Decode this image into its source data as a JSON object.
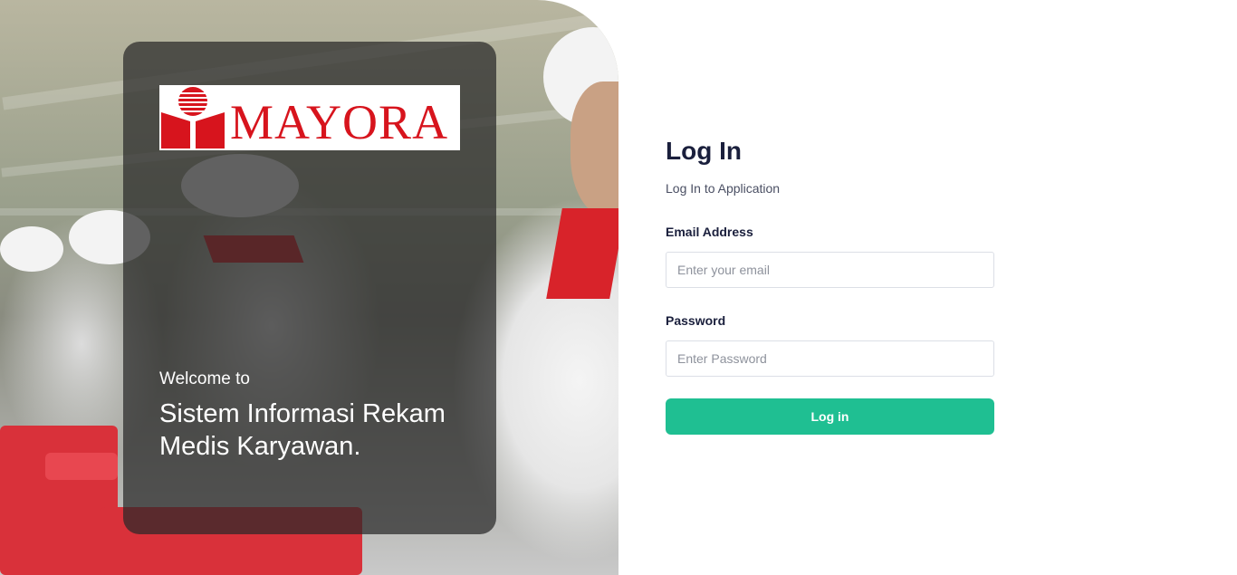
{
  "hero": {
    "welcome": "Welcome to",
    "system_title": "Sistem Informasi Rekam Medis Karyawan.",
    "logo_text": "MAYORA",
    "logo_color": "#d7141d"
  },
  "login": {
    "title": "Log In",
    "subtitle": "Log In to Application",
    "email_label": "Email Address",
    "email_placeholder": "Enter your email",
    "password_label": "Password",
    "password_placeholder": "Enter Password",
    "button_label": "Log in",
    "button_color": "#1fbf92"
  }
}
